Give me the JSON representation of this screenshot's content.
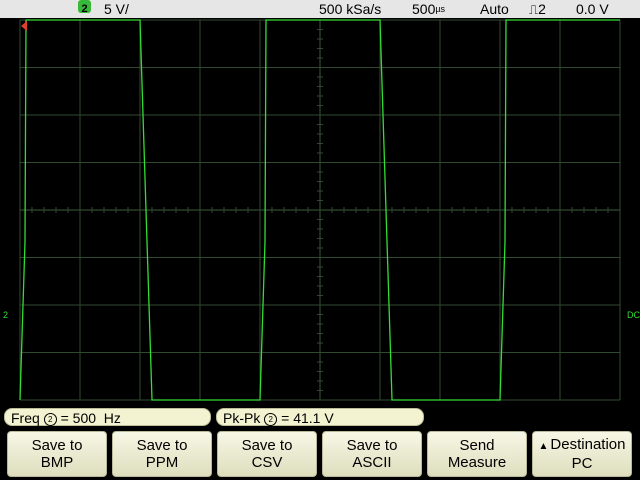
{
  "status": {
    "channel_number": "2",
    "volts_per_div": "5 V/",
    "sample_rate": "500 kSa/s",
    "time_per_div": "500",
    "time_unit": "µs",
    "trigger_mode": "Auto",
    "trigger_source": "2",
    "trigger_level": "0.0 V"
  },
  "markers": {
    "channel_ground": "2",
    "trigger_level": "DC"
  },
  "colors": {
    "trace": "#33dd33",
    "grid": "#2f4a2f",
    "status_bg": "#e6e6e6",
    "key_bg": "#eeeed4",
    "trigger_marker": "#e04030"
  },
  "waveform": {
    "type": "square",
    "frequency_hz": 500,
    "peak_to_peak_v": 41.1,
    "high_v": 20,
    "low_v": -20,
    "volts_per_div": 5,
    "time_per_div_us": 500,
    "center_v": 0,
    "rise_time_us": 100,
    "start_phase": "high"
  },
  "measurements": [
    {
      "label": "Freq",
      "channel": "2",
      "value": "500  Hz"
    },
    {
      "label": "Pk-Pk",
      "channel": "2",
      "value": "41.1 V"
    }
  ],
  "softkeys": [
    {
      "line1": "Save to",
      "line2": "BMP"
    },
    {
      "line1": "Save to",
      "line2": "PPM"
    },
    {
      "line1": "Save to",
      "line2": "CSV"
    },
    {
      "line1": "Save to",
      "line2": "ASCII"
    },
    {
      "line1": "Send",
      "line2": "Measure"
    },
    {
      "line1": "Destination",
      "line2": "PC",
      "icon": "up-arrow-icon"
    }
  ]
}
